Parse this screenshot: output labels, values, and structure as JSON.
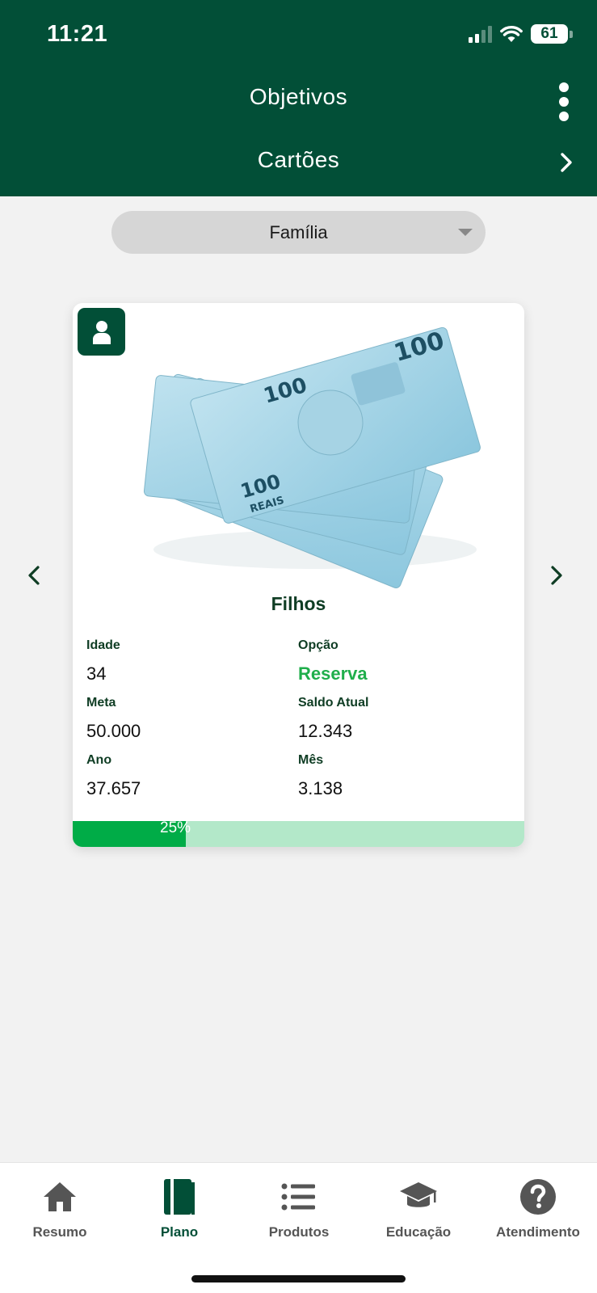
{
  "status_bar": {
    "time": "11:21",
    "battery": "61"
  },
  "header": {
    "title": "Objetivos",
    "subtitle": "Cartões"
  },
  "filter": {
    "selected": "Família"
  },
  "card": {
    "name": "Filhos",
    "fields": {
      "idade_label": "Idade",
      "idade_value": "34",
      "opcao_label": "Opção",
      "opcao_value": "Reserva",
      "meta_label": "Meta",
      "meta_value": "50.000",
      "saldo_label": "Saldo Atual",
      "saldo_value": "12.343",
      "ano_label": "Ano",
      "ano_value": "37.657",
      "mes_label": "Mês",
      "mes_value": "3.138"
    },
    "progress": {
      "label": "25%",
      "fraction": 0.25
    },
    "banknote_text": {
      "denomination": "100",
      "currency": "REAIS"
    }
  },
  "tabs": [
    {
      "label": "Resumo",
      "icon": "home-icon"
    },
    {
      "label": "Plano",
      "icon": "book-icon",
      "active": true
    },
    {
      "label": "Produtos",
      "icon": "list-icon"
    },
    {
      "label": "Educação",
      "icon": "graduation-cap-icon"
    },
    {
      "label": "Atendimento",
      "icon": "help-icon"
    }
  ],
  "colors": {
    "header_bg": "#024f37",
    "accent_green": "#00ac47",
    "progress_track": "#b3e8c9"
  }
}
